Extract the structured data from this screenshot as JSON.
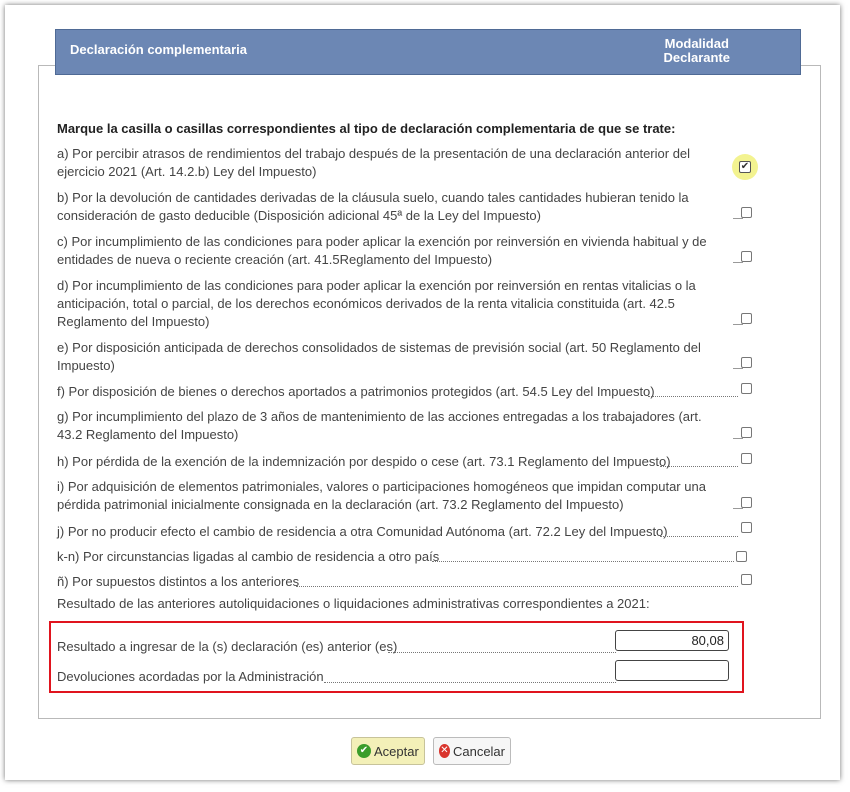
{
  "header": {
    "title": "Declaración complementaria",
    "right_line1": "Modalidad",
    "right_line2": "Declarante"
  },
  "instruction": "Marque la casilla o casillas correspondientes al tipo de declaración complementaria de que se trate:",
  "items": [
    {
      "text": "a) Por percibir atrasos de rendimientos del trabajo después de la presentación de una declaración anterior del ejercicio 2021 (Art. 14.2.b) Ley del Impuesto)",
      "checked": true
    },
    {
      "text": "b) Por la devolución de cantidades derivadas de la cláusula suelo, cuando tales cantidades hubieran tenido la consideración de gasto deducible (Disposición adicional 45ª de la Ley del Impuesto)",
      "checked": false
    },
    {
      "text": "c) Por incumplimiento de las condiciones para poder aplicar la exención por reinversión en vivienda habitual y de entidades de nueva o reciente creación (art. 41.5Reglamento del Impuesto)",
      "checked": false
    },
    {
      "text": "d) Por incumplimiento de las condiciones para poder aplicar la exención por reinversión en rentas vitalicias o la anticipación, total o parcial, de los derechos económicos derivados de la renta vitalicia constituida (art. 42.5 Reglamento del Impuesto)",
      "checked": false
    },
    {
      "text": "e) Por disposición anticipada de derechos consolidados de sistemas de previsión social (art. 50 Reglamento del Impuesto)",
      "checked": false
    },
    {
      "text": "f) Por disposición de bienes o derechos aportados a patrimonios protegidos (art. 54.5 Ley del Impuesto)",
      "checked": false
    },
    {
      "text": "g) Por incumplimiento del plazo de 3 años de mantenimiento de las acciones entregadas a los trabajadores (art. 43.2 Reglamento del Impuesto)",
      "checked": false
    },
    {
      "text": "h) Por pérdida de la exención de la indemnización por despido o cese (art. 73.1 Reglamento del Impuesto)",
      "checked": false
    },
    {
      "text": "i) Por adquisición de elementos patrimoniales, valores o participaciones homogéneos que impidan computar una pérdida patrimonial inicialmente consignada en la declaración (art. 73.2 Reglamento del Impuesto)",
      "checked": false
    },
    {
      "text": "j) Por no producir efecto el cambio de residencia a otra Comunidad Autónoma (art. 72.2 Ley del Impuesto)",
      "checked": false
    },
    {
      "text": "k-n) Por circunstancias ligadas al cambio de residencia a otro país",
      "checked": false
    },
    {
      "text": "ñ) Por supuestos distintos a los anteriores",
      "checked": false
    }
  ],
  "summary": {
    "title": "Resultado de las anteriores autoliquidaciones o liquidaciones administrativas correspondientes a 2021:",
    "field1_label": "Resultado a ingresar de la (s) declaración (es) anterior (es)",
    "field1_value": "80,08",
    "field2_label": "Devoluciones acordadas por la Administración",
    "field2_value": ""
  },
  "buttons": {
    "ok_label": "Aceptar",
    "cancel_label": "Cancelar"
  },
  "colors": {
    "header_bg": "#6c87b4",
    "highlight_box": "#e0141e",
    "ok_button_bg": "#f3f0b8"
  }
}
